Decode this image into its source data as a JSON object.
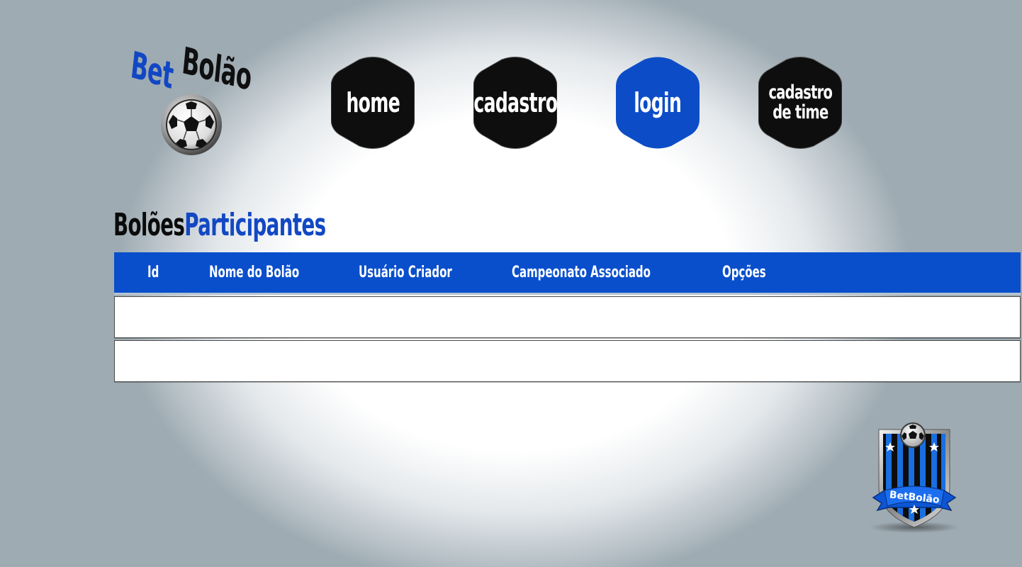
{
  "logo": {
    "bet": "Bet",
    "bolao": "Bolão"
  },
  "nav": {
    "home": "home",
    "cadastro": "cadastro",
    "login": "login",
    "cadastro_time_line1": "cadastro",
    "cadastro_time_line2": "de time"
  },
  "colors": {
    "accent": "#094fcc",
    "dark": "#0f0f10",
    "active_nav": "#0c4dc7"
  },
  "section": {
    "title_part1": "Bolões",
    "title_part2": "Participantes"
  },
  "table": {
    "columns": [
      "Id",
      "Nome do Bolão",
      "Usuário Criador",
      "Campeonato Associado",
      "Opções"
    ]
  },
  "badge": {
    "text": "BetBolão"
  }
}
